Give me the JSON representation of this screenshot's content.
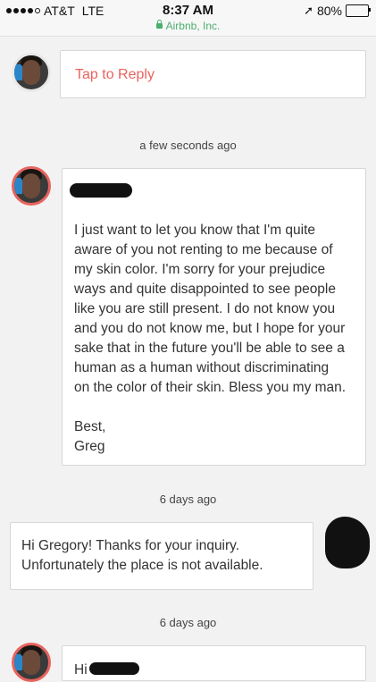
{
  "status_bar": {
    "carrier": "AT&T",
    "network": "LTE",
    "time": "8:37 AM",
    "app": "Airbnb, Inc.",
    "battery": "80%",
    "battery_level": 0.8
  },
  "reply_prompt": {
    "label": "Tap to Reply"
  },
  "thread": {
    "timestamps": [
      "a few seconds ago",
      "6 days ago",
      "6 days ago"
    ],
    "message_from_guest": {
      "lines": [
        "I just want to let you know that I'm quite",
        "aware of you not renting to me because of",
        "my skin color. I'm sorry for your prejudice",
        "ways and quite disappointed to see people",
        "like you are still present. I do not know you",
        "and you do not know me, but I hope for your",
        "sake that in the future you'll be able to see a",
        "human as a human without discriminating",
        "on the color of their skin. Bless you my man."
      ],
      "sign_off": [
        "Best,",
        "Greg"
      ]
    },
    "message_from_host": {
      "lines": [
        "Hi Gregory! Thanks for your inquiry.",
        "Unfortunately the place is not available."
      ]
    },
    "partial_message_start": "Hi"
  }
}
